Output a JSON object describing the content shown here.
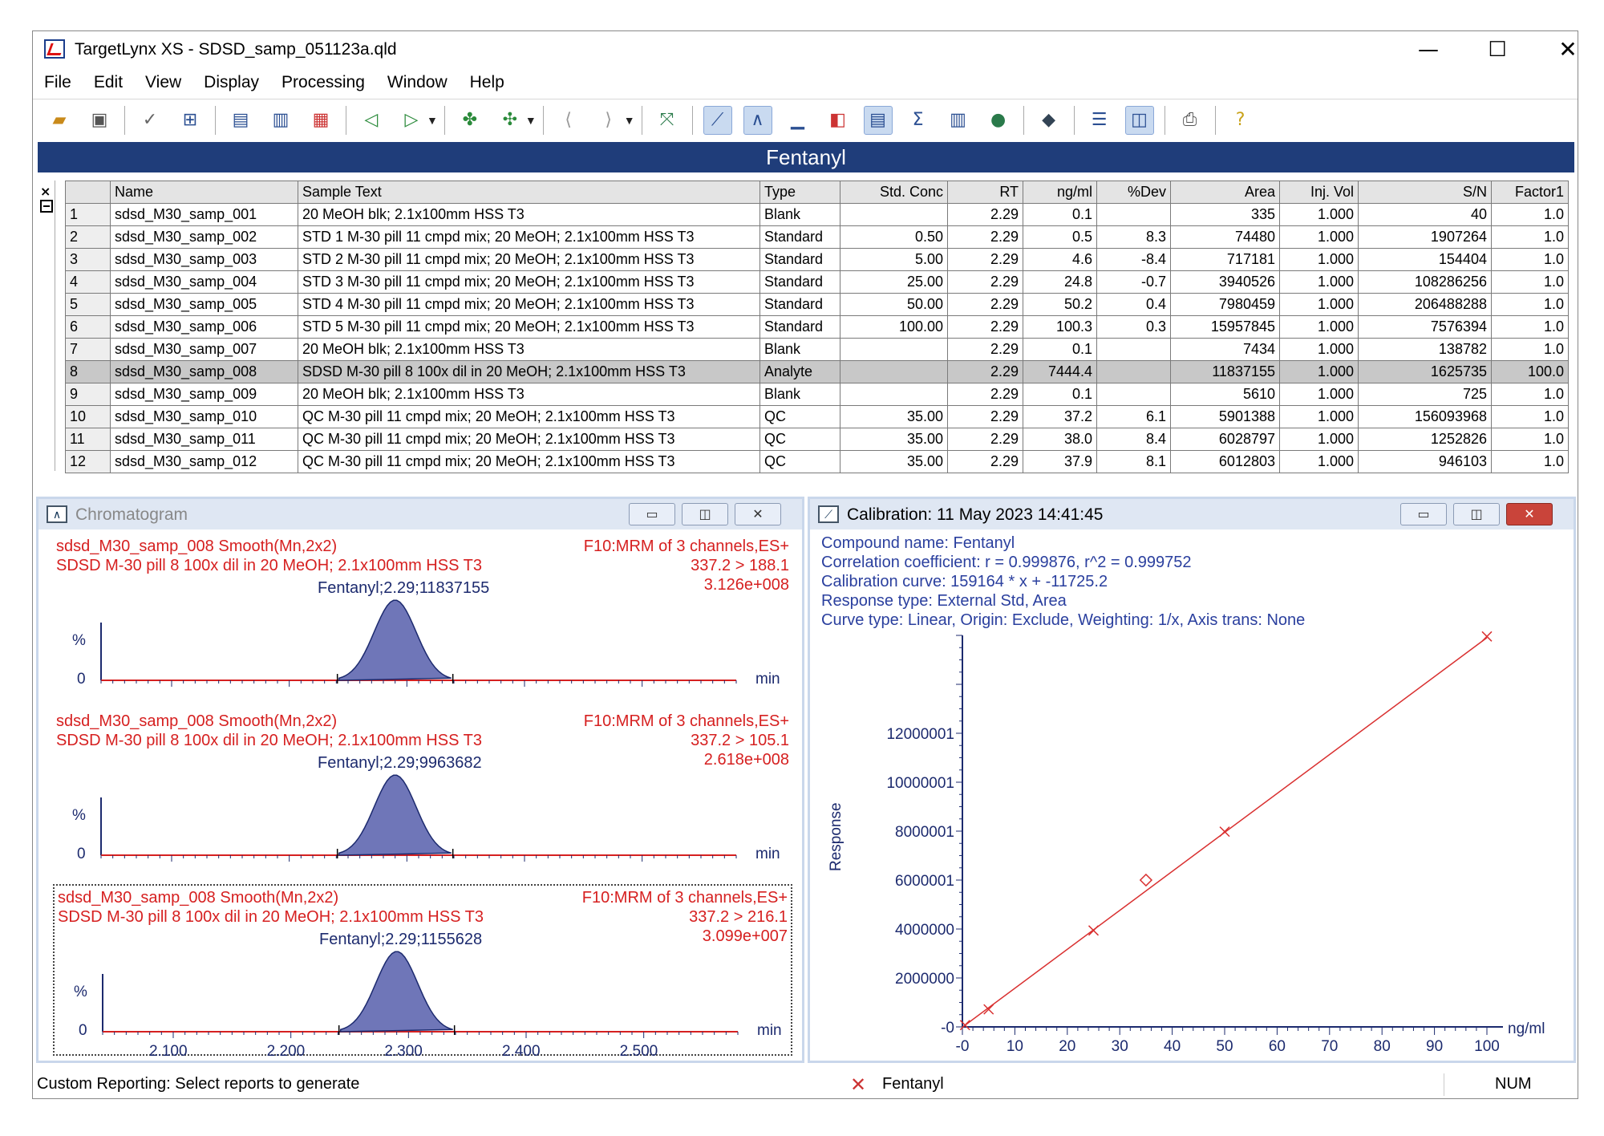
{
  "window": {
    "title": "TargetLynx XS - SDSD_samp_051123a.qld",
    "minimize": "—",
    "maximize": "☐",
    "close": "✕"
  },
  "menu": [
    "File",
    "Edit",
    "View",
    "Display",
    "Processing",
    "Window",
    "Help"
  ],
  "toolbar_icons": [
    "open-folder-icon",
    "save-icon",
    "check-icon",
    "integrate-icon",
    "report-icon",
    "preview-icon",
    "print-preview-icon",
    "prev-sample-icon",
    "next-sample-icon",
    "prev-compound-icon",
    "next-compound-icon",
    "prev-peak-icon",
    "next-peak-icon",
    "fit-icon",
    "calibration-view-icon",
    "chromatogram-view-icon",
    "spectrum-view-icon",
    "summary-icon",
    "table-view-icon",
    "sum-icon",
    "book-icon",
    "globe-icon",
    "eraser-icon",
    "split-horizontal-icon",
    "split-vertical-icon",
    "print-icon",
    "help-icon"
  ],
  "compound_header": "Fentanyl",
  "grid": {
    "columns": [
      "",
      "Name",
      "Sample Text",
      "Type",
      "Std. Conc",
      "RT",
      "ng/ml",
      "%Dev",
      "Area",
      "Inj. Vol",
      "S/N",
      "Factor1"
    ],
    "rows": [
      [
        "1",
        "sdsd_M30_samp_001",
        "20 MeOH blk; 2.1x100mm HSS T3",
        "Blank",
        "",
        "2.29",
        "0.1",
        "",
        "335",
        "1.000",
        "40",
        "1.0"
      ],
      [
        "2",
        "sdsd_M30_samp_002",
        "STD 1 M-30 pill 11 cmpd mix; 20 MeOH; 2.1x100mm HSS T3",
        "Standard",
        "0.50",
        "2.29",
        "0.5",
        "8.3",
        "74480",
        "1.000",
        "1907264",
        "1.0"
      ],
      [
        "3",
        "sdsd_M30_samp_003",
        "STD 2 M-30 pill 11 cmpd mix; 20 MeOH; 2.1x100mm HSS T3",
        "Standard",
        "5.00",
        "2.29",
        "4.6",
        "-8.4",
        "717181",
        "1.000",
        "154404",
        "1.0"
      ],
      [
        "4",
        "sdsd_M30_samp_004",
        "STD 3 M-30 pill 11 cmpd mix; 20 MeOH; 2.1x100mm HSS T3",
        "Standard",
        "25.00",
        "2.29",
        "24.8",
        "-0.7",
        "3940526",
        "1.000",
        "108286256",
        "1.0"
      ],
      [
        "5",
        "sdsd_M30_samp_005",
        "STD 4 M-30 pill 11 cmpd mix; 20 MeOH; 2.1x100mm HSS T3",
        "Standard",
        "50.00",
        "2.29",
        "50.2",
        "0.4",
        "7980459",
        "1.000",
        "206488288",
        "1.0"
      ],
      [
        "6",
        "sdsd_M30_samp_006",
        "STD 5 M-30 pill 11 cmpd mix; 20 MeOH; 2.1x100mm HSS T3",
        "Standard",
        "100.00",
        "2.29",
        "100.3",
        "0.3",
        "15957845",
        "1.000",
        "7576394",
        "1.0"
      ],
      [
        "7",
        "sdsd_M30_samp_007",
        "20 MeOH blk; 2.1x100mm HSS T3",
        "Blank",
        "",
        "2.29",
        "0.1",
        "",
        "7434",
        "1.000",
        "138782",
        "1.0"
      ],
      [
        "8",
        "sdsd_M30_samp_008",
        "SDSD M-30 pill 8 100x dil in 20 MeOH; 2.1x100mm HSS T3",
        "Analyte",
        "",
        "2.29",
        "7444.4",
        "",
        "11837155",
        "1.000",
        "1625735",
        "100.0"
      ],
      [
        "9",
        "sdsd_M30_samp_009",
        "20 MeOH blk; 2.1x100mm HSS T3",
        "Blank",
        "",
        "2.29",
        "0.1",
        "",
        "5610",
        "1.000",
        "725",
        "1.0"
      ],
      [
        "10",
        "sdsd_M30_samp_010",
        "QC  M-30 pill 11 cmpd mix; 20 MeOH; 2.1x100mm HSS T3",
        "QC",
        "35.00",
        "2.29",
        "37.2",
        "6.1",
        "5901388",
        "1.000",
        "156093968",
        "1.0"
      ],
      [
        "11",
        "sdsd_M30_samp_011",
        "QC  M-30 pill 11 cmpd mix; 20 MeOH; 2.1x100mm HSS T3",
        "QC",
        "35.00",
        "2.29",
        "38.0",
        "8.4",
        "6028797",
        "1.000",
        "1252826",
        "1.0"
      ],
      [
        "12",
        "sdsd_M30_samp_012",
        "QC  M-30 pill 11 cmpd mix; 20 MeOH; 2.1x100mm HSS T3",
        "QC",
        "35.00",
        "2.29",
        "37.9",
        "8.1",
        "6012803",
        "1.000",
        "946103",
        "1.0"
      ]
    ],
    "selected_row": 7
  },
  "chromatogram": {
    "title": "Chromatogram",
    "traces": [
      {
        "line1_left": "sdsd_M30_samp_008 Smooth(Mn,2x2)",
        "line1_right": "F10:MRM of 3 channels,ES+",
        "line2_left": "SDSD M-30 pill 8 100x dil in 20 MeOH; 2.1x100mm HSS T3",
        "line2_right": "337.2 > 188.1",
        "line3_right": "3.126e+008",
        "peak_label": "Fentanyl;2.29;11837155",
        "pct": "%",
        "zero": "0",
        "unit": "min"
      },
      {
        "line1_left": "sdsd_M30_samp_008 Smooth(Mn,2x2)",
        "line1_right": "F10:MRM of 3 channels,ES+",
        "line2_left": "SDSD M-30 pill 8 100x dil in 20 MeOH; 2.1x100mm HSS T3",
        "line2_right": "337.2 > 105.1",
        "line3_right": "2.618e+008",
        "peak_label": "Fentanyl;2.29;9963682",
        "pct": "%",
        "zero": "0",
        "unit": "min"
      },
      {
        "line1_left": "sdsd_M30_samp_008 Smooth(Mn,2x2)",
        "line1_right": "F10:MRM of 3 channels,ES+",
        "line2_left": "SDSD M-30 pill 8 100x dil in 20 MeOH; 2.1x100mm HSS T3",
        "line2_right": "337.2 > 216.1",
        "line3_right": "3.099e+007",
        "peak_label": "Fentanyl;2.29;1155628",
        "pct": "%",
        "zero": "0",
        "unit": "min"
      }
    ],
    "x_ticks": [
      "2.100",
      "2.200",
      "2.300",
      "2.400",
      "2.500"
    ]
  },
  "calibration": {
    "title": "Calibration: 11 May 2023 14:41:45",
    "info": [
      "Compound name: Fentanyl",
      "Correlation coefficient: r = 0.999876, r^2 = 0.999752",
      "Calibration curve: 159164 * x + -11725.2",
      "Response type: External Std, Area",
      "Curve type: Linear, Origin: Exclude, Weighting: 1/x, Axis trans: None"
    ],
    "ylabel": "Response",
    "xunit": "ng/ml"
  },
  "chart_data": {
    "type": "scatter",
    "x": [
      0.5,
      5.0,
      25.0,
      35.0,
      50.0,
      100.0
    ],
    "y": [
      74480,
      717181,
      3940526,
      6000000,
      7980459,
      15957845
    ],
    "fit": {
      "slope": 159164,
      "intercept": -11725.2
    },
    "xlim": [
      0,
      100
    ],
    "ylim": [
      0,
      16000000
    ],
    "x_tick_labels": [
      "-0",
      "10",
      "20",
      "30",
      "40",
      "50",
      "60",
      "70",
      "80",
      "90",
      "100"
    ],
    "y_tick_labels": [
      "-0",
      "2000000",
      "4000000",
      "6000001",
      "8000001",
      "10000001",
      "12000001"
    ],
    "y_tick_values": [
      0,
      2000000,
      4000000,
      6000001,
      8000001,
      10000001,
      12000001
    ],
    "ylabel": "Response",
    "xlabel": "ng/ml",
    "colors": {
      "line": "#d93030",
      "axis": "#1c2a6e"
    }
  },
  "status": {
    "left": "Custom Reporting:  Select reports to generate",
    "compound": "Fentanyl",
    "num": "NUM"
  }
}
